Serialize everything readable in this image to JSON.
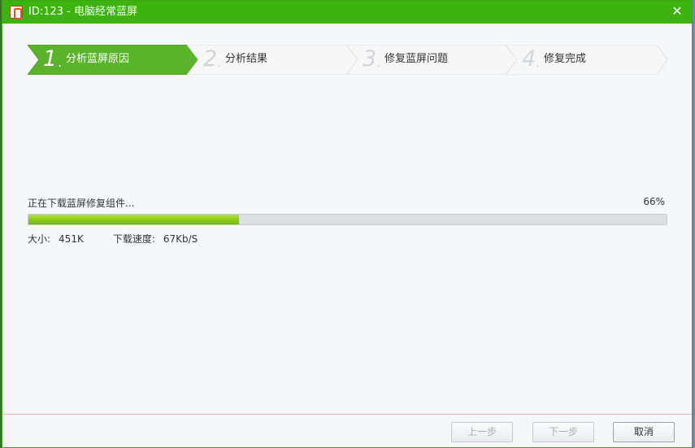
{
  "window": {
    "title": "ID:123 - 电脑经常蓝屏",
    "close_glyph": "✕",
    "accent_color": "#3cb30e"
  },
  "steps": [
    {
      "number": "1",
      "dot": ".",
      "label": "分析蓝屏原因",
      "active": true
    },
    {
      "number": "2",
      "dot": ".",
      "label": "分析结果",
      "active": false
    },
    {
      "number": "3",
      "dot": ".",
      "label": "修复蓝屏问题",
      "active": false
    },
    {
      "number": "4",
      "dot": ".",
      "label": "修复完成",
      "active": false
    }
  ],
  "progress": {
    "status": "正在下载蓝屏修复组件...",
    "percent_label": "66%",
    "fill_fraction": 0.33,
    "size_label": "大小:",
    "size_value": "451K",
    "speed_label": "下载速度:",
    "speed_value": "67Kb/S"
  },
  "footer": {
    "prev_label": "上一步",
    "next_label": "下一步",
    "cancel_label": "取消"
  }
}
